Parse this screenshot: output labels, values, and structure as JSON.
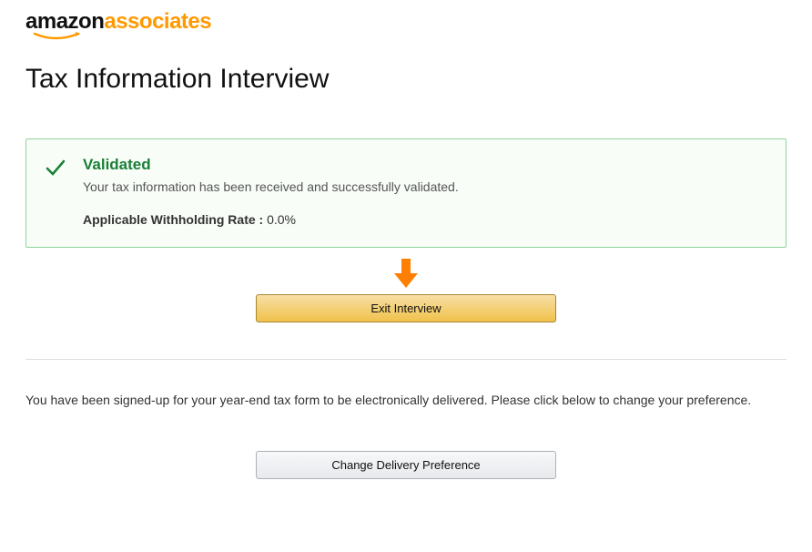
{
  "logo": {
    "brand_first": "amazon",
    "brand_second": "associates"
  },
  "page_title": "Tax Information Interview",
  "status": {
    "title": "Validated",
    "message": "Your tax information has been received and successfully validated.",
    "withholding_label": "Applicable Withholding Rate : ",
    "withholding_value": "0.0%"
  },
  "exit_button": "Exit Interview",
  "delivery_message": "You have been signed-up for your year-end tax form to be electronically delivered. Please click below to change your preference.",
  "change_pref_button": "Change Delivery Preference"
}
